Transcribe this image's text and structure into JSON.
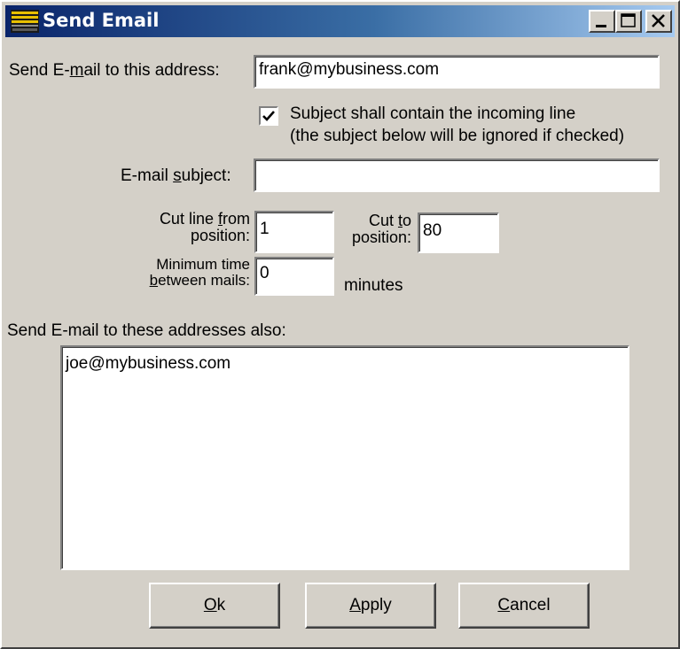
{
  "window": {
    "title": "Send Email",
    "controls": [
      "minimize-icon",
      "maximize-icon",
      "close-icon"
    ]
  },
  "form": {
    "to_label_pre": "Send E-",
    "to_label_mn": "m",
    "to_label_post": "ail to this address:",
    "to_value": "frank@mybusiness.com",
    "checkbox_checked": true,
    "checkbox_line1": "Subject shall contain the incoming line",
    "checkbox_line2": "(the subject below will be ignored if checked)",
    "subject_label_pre": "E-mail ",
    "subject_label_mn": "s",
    "subject_label_post": "ubject:",
    "subject_value": "",
    "cut_from_line1_pre": "Cut line ",
    "cut_from_line1_mn": "f",
    "cut_from_line1_post": "rom",
    "cut_from_line2": "position:",
    "cut_from_value": "1",
    "cut_to_line1_pre": "Cut ",
    "cut_to_line1_mn": "t",
    "cut_to_line1_post": "o",
    "cut_to_line2": "position:",
    "cut_to_value": "80",
    "min_time_line1": "Minimum time",
    "min_time_line2_mn": "b",
    "min_time_line2_post": "etween mails:",
    "min_time_value": "0",
    "minutes_label": "minutes",
    "also_label": "Send E-mail to these addresses also:",
    "also_values": [
      "joe@mybusiness.com"
    ]
  },
  "buttons": {
    "ok_mn": "O",
    "ok_post": "k",
    "apply_mn": "A",
    "apply_post": "pply",
    "cancel_mn": "C",
    "cancel_post": "ancel"
  },
  "colors": {
    "title_start": "#0a246a",
    "title_end": "#a6caf0",
    "face": "#d4d0c8"
  }
}
